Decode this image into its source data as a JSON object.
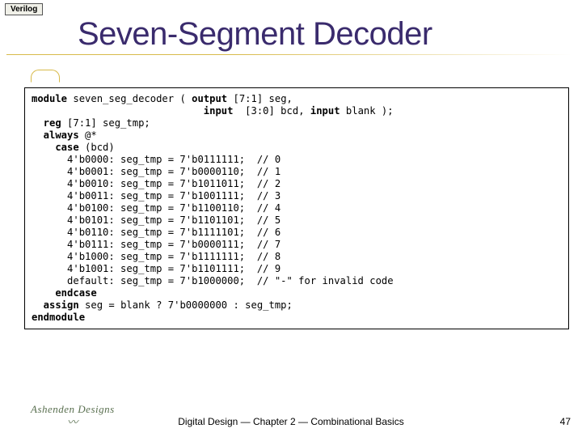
{
  "tab": "Verilog",
  "title": "Seven-Segment Decoder",
  "code": {
    "l1a": "module",
    "l1b": " seven_seg_decoder ( ",
    "l1c": "output",
    "l1d": " [7:1] seg,",
    "l2a": "                             ",
    "l2b": "input",
    "l2c": "  [3:0] bcd, ",
    "l2d": "input",
    "l2e": " blank );",
    "l3a": "  reg",
    "l3b": " [7:1] seg_tmp;",
    "l4a": "  always",
    "l4b": " @*",
    "l5a": "    case",
    "l5b": " (bcd)",
    "rows": [
      "      4'b0000: seg_tmp = 7'b0111111;  // 0",
      "      4'b0001: seg_tmp = 7'b0000110;  // 1",
      "      4'b0010: seg_tmp = 7'b1011011;  // 2",
      "      4'b0011: seg_tmp = 7'b1001111;  // 3",
      "      4'b0100: seg_tmp = 7'b1100110;  // 4",
      "      4'b0101: seg_tmp = 7'b1101101;  // 5",
      "      4'b0110: seg_tmp = 7'b1111101;  // 6",
      "      4'b0111: seg_tmp = 7'b0000111;  // 7",
      "      4'b1000: seg_tmp = 7'b1111111;  // 8",
      "      4'b1001: seg_tmp = 7'b1101111;  // 9",
      "      default: seg_tmp = 7'b1000000;  // \"-\" for invalid code"
    ],
    "endcase": "    endcase",
    "assignA": "  assign",
    "assignB": " seg = blank ? 7'b0000000 : seg_tmp;",
    "endmodule": "endmodule"
  },
  "footer": {
    "logo": "Ashenden Designs",
    "center": "Digital Design — Chapter 2 — Combinational Basics",
    "page": "47"
  }
}
